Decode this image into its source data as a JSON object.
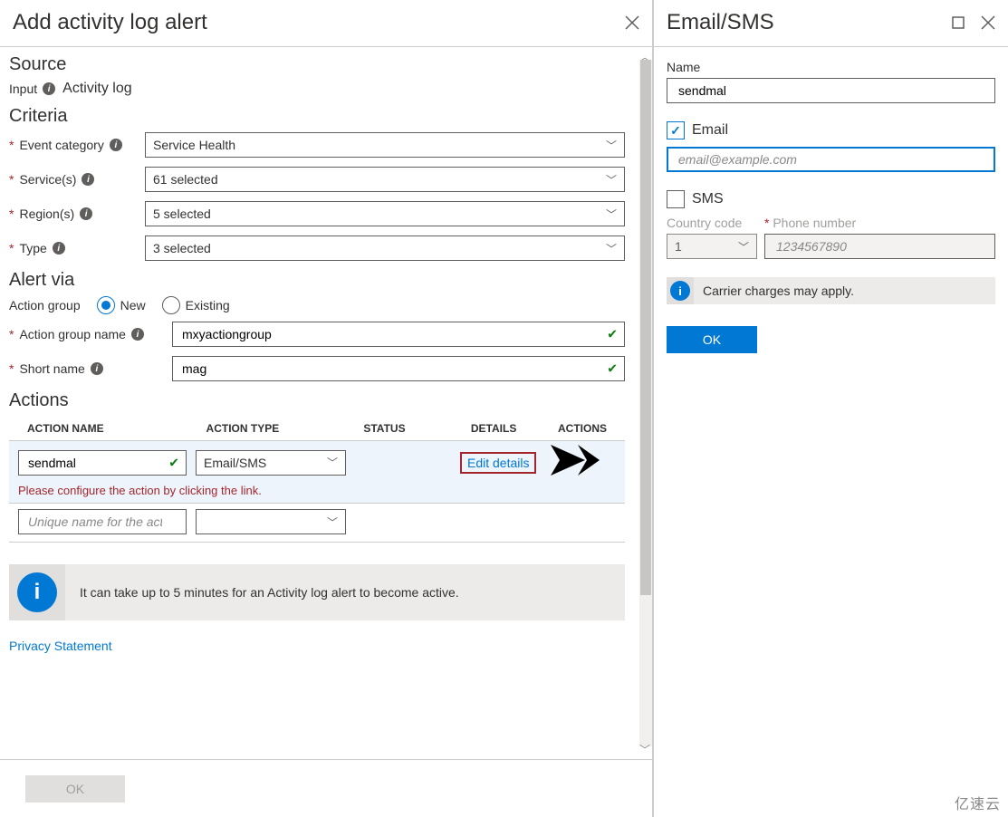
{
  "leftPanel": {
    "title": "Add activity log alert",
    "source": {
      "heading": "Source",
      "inputLabel": "Input",
      "inputValue": "Activity log"
    },
    "criteria": {
      "heading": "Criteria",
      "fields": {
        "eventCategory": {
          "label": "Event category",
          "value": "Service Health"
        },
        "services": {
          "label": "Service(s)",
          "value": "61 selected"
        },
        "regions": {
          "label": "Region(s)",
          "value": "5 selected"
        },
        "type": {
          "label": "Type",
          "value": "3 selected"
        }
      }
    },
    "alertVia": {
      "heading": "Alert via",
      "actionGroupLabel": "Action group",
      "newLabel": "New",
      "existingLabel": "Existing",
      "actionGroupName": {
        "label": "Action group name",
        "value": "mxyactiongroup"
      },
      "shortName": {
        "label": "Short name",
        "value": "mag"
      }
    },
    "actions": {
      "heading": "Actions",
      "columns": {
        "name": "Action Name",
        "type": "Action Type",
        "status": "Status",
        "details": "Details",
        "actions": "Actions"
      },
      "row1": {
        "name": "sendmal",
        "type": "Email/SMS",
        "detailsLink": "Edit details",
        "error": "Please configure the action by clicking the link."
      },
      "emptyRowPlaceholder": "Unique name for the action"
    },
    "infoBanner": "It can take up to 5 minutes for an Activity log alert to become active.",
    "privacyLink": "Privacy Statement",
    "okButton": "OK"
  },
  "rightPanel": {
    "title": "Email/SMS",
    "nameLabel": "Name",
    "nameValue": "sendmal",
    "emailCheckboxLabel": "Email",
    "emailPlaceholder": "email@example.com",
    "smsCheckboxLabel": "SMS",
    "countryCodeLabel": "Country code",
    "countryCodeValue": "1",
    "phoneLabel": "Phone number",
    "phonePlaceholder": "1234567890",
    "carrierInfo": "Carrier charges may apply.",
    "okButton": "OK"
  },
  "watermark": "亿速云"
}
